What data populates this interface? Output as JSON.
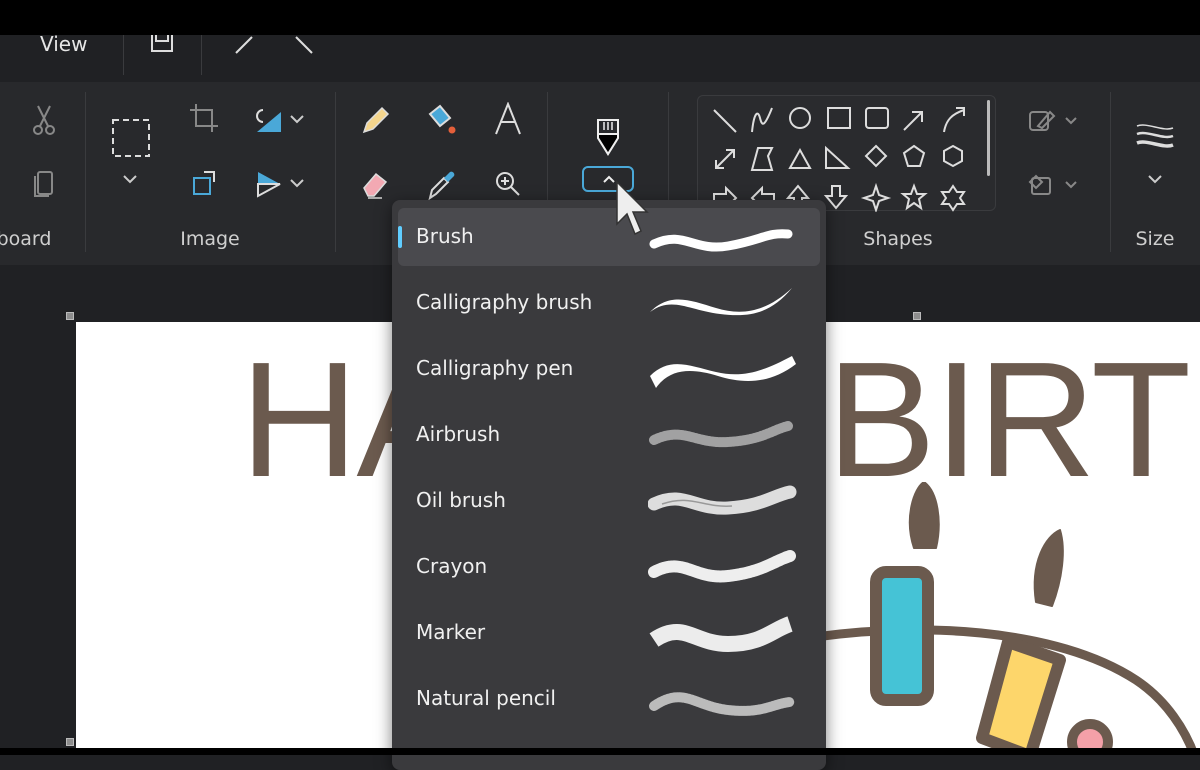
{
  "menu": {
    "view_label": "View",
    "icons": [
      "save-icon",
      "redo-icon",
      "undo-icon"
    ]
  },
  "ribbon": {
    "groups": [
      {
        "label": "board"
      },
      {
        "label": "Image"
      },
      {
        "label": "Shapes"
      },
      {
        "label": "Size"
      }
    ],
    "tools": [
      "cut-icon",
      "copy-icon",
      "select-icon",
      "crop-icon",
      "rotate-icon",
      "resize-icon",
      "flip-icon",
      "pencil-icon",
      "fill-icon",
      "text-icon",
      "eraser-icon",
      "color-picker-icon",
      "magnifier-icon",
      "brush-icon"
    ],
    "shapes": [
      "line",
      "curve",
      "oval",
      "rectangle",
      "rounded-rectangle",
      "arrow-ne",
      "curved-arrow",
      "double-arrow",
      "polygon",
      "triangle",
      "right-triangle",
      "diamond",
      "pentagon",
      "hexagon",
      "arrow-right",
      "arrow-left",
      "arrow-up",
      "arrow-down",
      "star-4",
      "star-5",
      "star-6"
    ]
  },
  "brush_menu": {
    "selected": "Brush",
    "items": [
      {
        "label": "Brush"
      },
      {
        "label": "Calligraphy brush"
      },
      {
        "label": "Calligraphy pen"
      },
      {
        "label": "Airbrush"
      },
      {
        "label": "Oil brush"
      },
      {
        "label": "Crayon"
      },
      {
        "label": "Marker"
      },
      {
        "label": "Natural pencil"
      }
    ]
  },
  "canvas": {
    "text": "HAPPY BIRTHDAY"
  },
  "colors": {
    "accent": "#60cdff",
    "text_brown": "#6b5a4e",
    "candle_blue": "#45c3d6",
    "candle_yellow": "#fdd66b",
    "dot_pink": "#f4a0a8"
  }
}
